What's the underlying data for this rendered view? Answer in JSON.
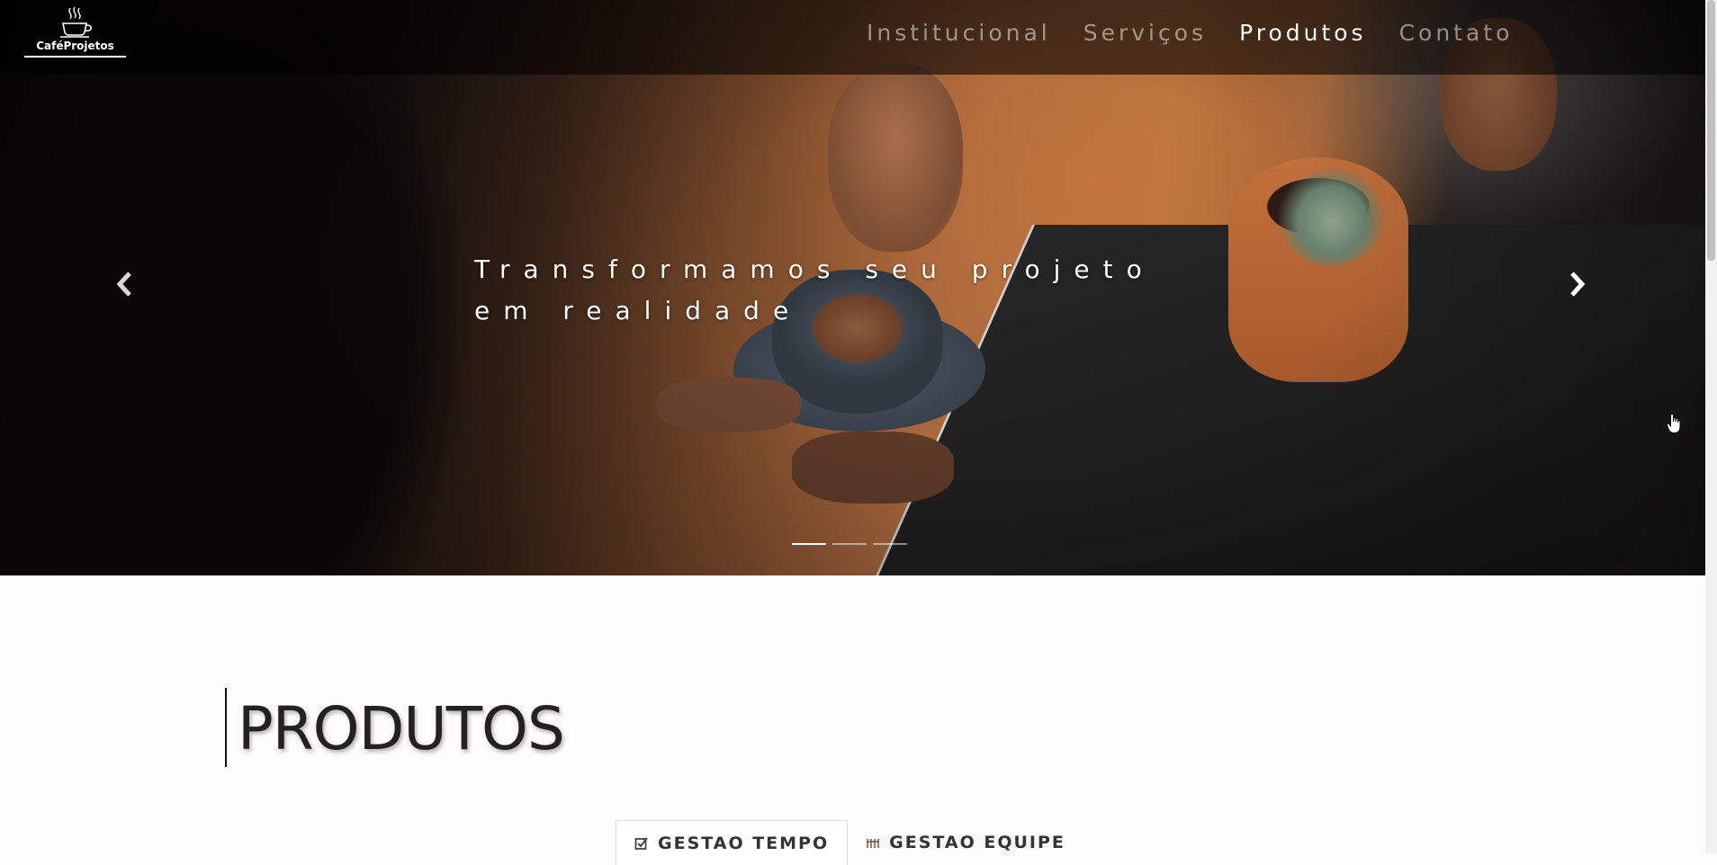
{
  "brand": {
    "name": "CaféProjetos"
  },
  "nav": {
    "items": [
      {
        "label": "Institucional",
        "active": false
      },
      {
        "label": "Serviços",
        "active": false
      },
      {
        "label": "Produtos",
        "active": true
      },
      {
        "label": "Contato",
        "active": false
      }
    ]
  },
  "carousel": {
    "caption_line1": "Transformamos seu projeto",
    "caption_line2": "em realidade",
    "slide_count": 3,
    "active_slide": 1
  },
  "section": {
    "title": "PRODUTOS"
  },
  "tabs": [
    {
      "label": "GESTAO TEMPO",
      "icon": "checkbox-icon",
      "active": true
    },
    {
      "label": "GESTAO EQUIPE",
      "icon": "team-icon",
      "active": false
    }
  ],
  "colors": {
    "nav_bg": "rgba(0,0,0,0.58)",
    "nav_text_inactive": "rgba(255,255,255,0.5)",
    "nav_text_active": "#ffffff",
    "page_bg": "#fdfbfb",
    "title_color": "#222222"
  }
}
